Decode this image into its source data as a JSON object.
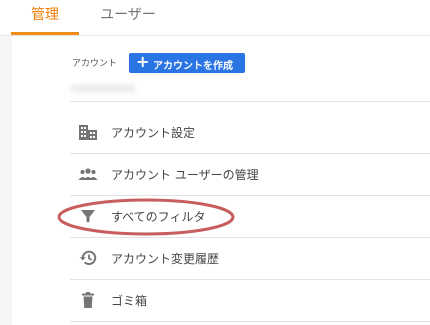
{
  "tabs": {
    "admin_label": "管理",
    "user_label": "ユーザー"
  },
  "account": {
    "label": "アカウント",
    "create_button_plus": "+",
    "create_button_label": "アカウントを作成"
  },
  "menu": {
    "items": [
      {
        "label": "アカウント設定",
        "icon": "building-icon"
      },
      {
        "label": "アカウント ユーザーの管理",
        "icon": "people-icon"
      },
      {
        "label": "すべてのフィルタ",
        "icon": "filter-icon"
      },
      {
        "label": "アカウント変更履歴",
        "icon": "history-icon"
      },
      {
        "label": "ゴミ箱",
        "icon": "trash-icon"
      }
    ]
  },
  "colors": {
    "active_tab": "#f07c00",
    "button_blue": "#2a74e3",
    "highlight_ellipse": "#c75d5d",
    "icon_gray": "#757575"
  }
}
